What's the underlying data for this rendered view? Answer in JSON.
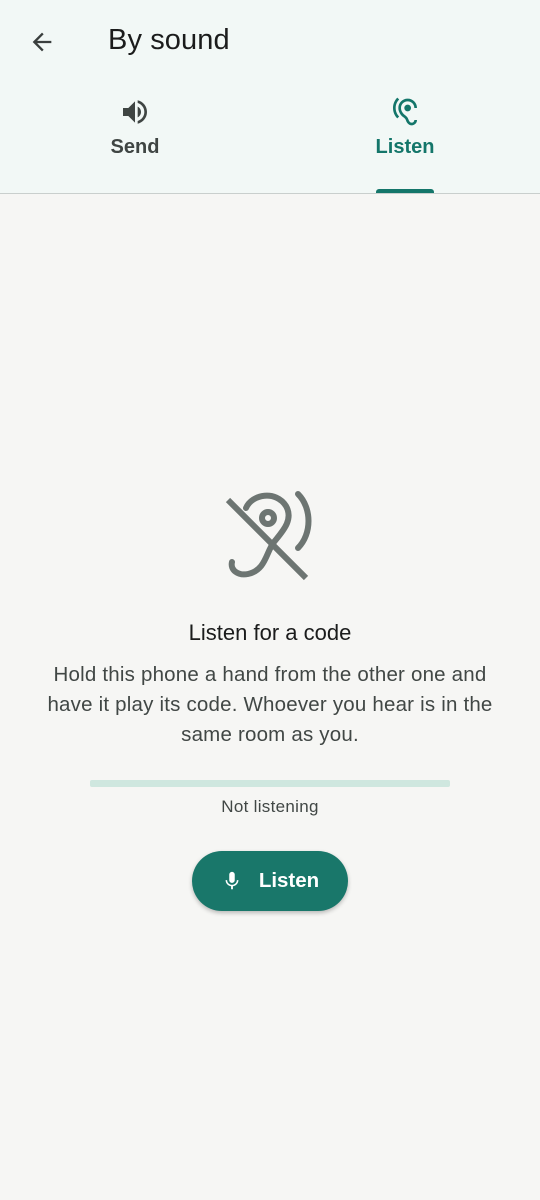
{
  "appbar": {
    "title": "By sound",
    "back_icon": "arrow-back-icon"
  },
  "tabs": [
    {
      "label": "Send",
      "icon": "volume-up-icon",
      "selected": false
    },
    {
      "label": "Listen",
      "icon": "hearing-icon",
      "selected": true
    }
  ],
  "main": {
    "hero_icon": "hearing-disabled-icon",
    "heading": "Listen for a code",
    "description": "Hold this phone a hand from the other one and have it play its code. Whoever you hear is in the same room as you.",
    "progress_fraction": 0,
    "status": "Not listening",
    "button": {
      "label": "Listen",
      "icon": "mic-icon"
    }
  },
  "colors": {
    "accent": "#14766a",
    "header_bg": "#f2f8f6",
    "page_bg": "#f6f6f4",
    "track": "#cfe7df"
  }
}
